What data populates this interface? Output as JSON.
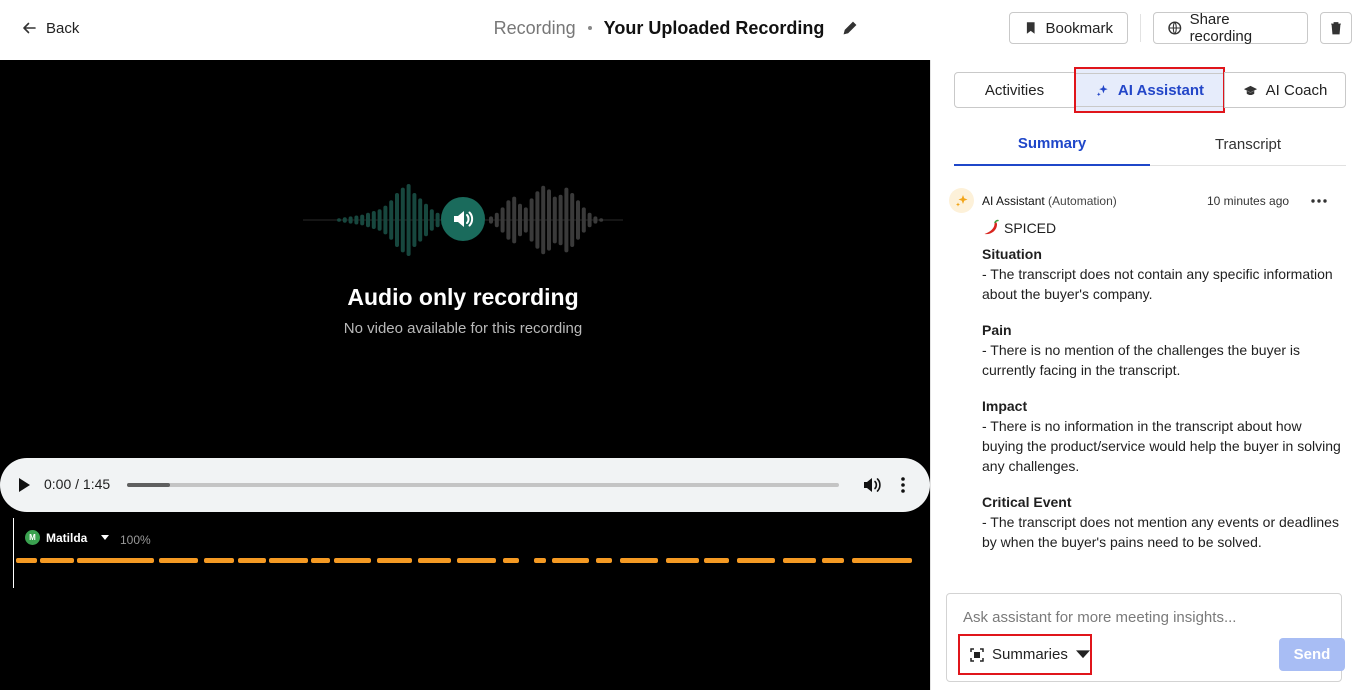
{
  "topbar": {
    "back_label": "Back",
    "breadcrumb_parent": "Recording",
    "title": "Your Uploaded Recording",
    "bookmark_label": "Bookmark",
    "share_label": "Share recording"
  },
  "player": {
    "title": "Audio only recording",
    "subtitle": "No video available for this recording",
    "time": "0:00 / 1:45",
    "progress": 0.06,
    "speaker": {
      "initial": "M",
      "name": "Matilda",
      "percent": "100%",
      "avatar_color": "#3aa14f"
    },
    "talk_color": "#f59a23",
    "accent_color": "#1a6b5c"
  },
  "panel": {
    "tabs": [
      {
        "label": "Activities"
      },
      {
        "label": "AI Assistant"
      },
      {
        "label": "AI Coach"
      }
    ],
    "subtabs": [
      {
        "label": "Summary"
      },
      {
        "label": "Transcript"
      }
    ],
    "message": {
      "author": "AI Assistant",
      "role": "(Automation)",
      "time": "10 minutes ago",
      "heading": "SPICED",
      "sections": [
        {
          "title": "Situation",
          "text": "- The transcript does not contain any specific information about the buyer's company."
        },
        {
          "title": "Pain",
          "text": "- There is no mention of the challenges the buyer is currently facing in the transcript."
        },
        {
          "title": "Impact",
          "text": "- There is no information in the transcript about how buying the product/service would help the buyer in solving any challenges."
        },
        {
          "title": "Critical Event",
          "text": "- The transcript does not mention any events or deadlines by when the buyer's pains need to be solved."
        }
      ]
    },
    "ask": {
      "placeholder": "Ask assistant for more meeting insights...",
      "mode_label": "Summaries",
      "send_label": "Send"
    },
    "accent_color": "#1f47c9"
  }
}
